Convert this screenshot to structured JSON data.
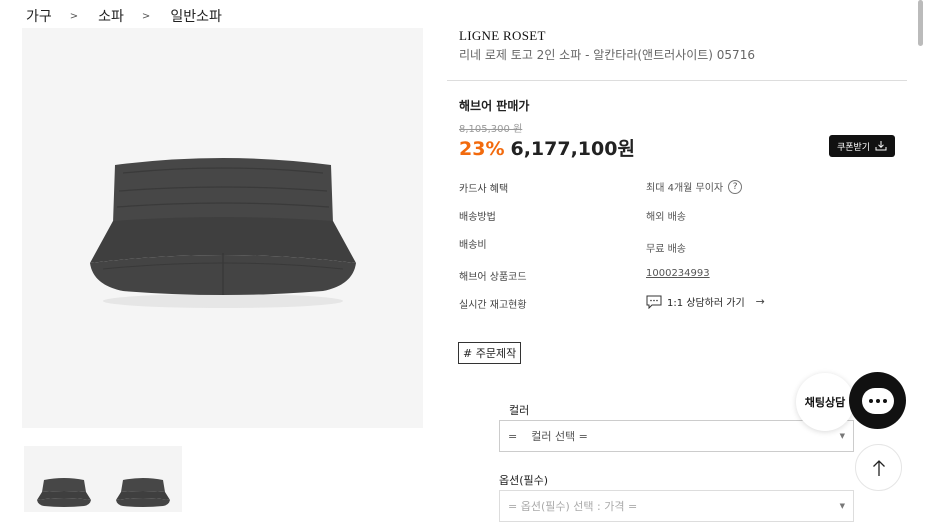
{
  "breadcrumb": {
    "items": [
      "가구",
      "소파",
      "일반소파"
    ],
    "separator": ">"
  },
  "product": {
    "brand": "LIGNE ROSET",
    "name": "리네 로제 토고 2인 소파 - 알칸타라(앤트러사이트) 05716"
  },
  "price": {
    "title": "해브어 판매가",
    "original": "8,105,300 원",
    "discount": "23%",
    "sale": "6,177,100원",
    "coupon_label": "쿠폰받기"
  },
  "info": [
    {
      "label": "카드사 혜택",
      "value": "최대 4개월 무이자"
    },
    {
      "label": "배송방법",
      "value": "해외 배송"
    },
    {
      "label": "배송비",
      "value": "무료 배송"
    },
    {
      "label": "해브어 상품코드",
      "value": "1000234993"
    },
    {
      "label": "실시간 재고현황",
      "value": "1:1 상담하러 가기"
    }
  ],
  "tag": "# 주문제작",
  "options": {
    "color_label": "컬러",
    "color_placeholder": "=    컬러 선택 =",
    "option_label": "옵션(필수)",
    "option_placeholder": "= 옵션(필수) 선택 : 가격 ="
  },
  "chat": {
    "label": "채팅상담"
  },
  "colors": {
    "accent": "#f26a0d",
    "dark": "#111111"
  },
  "icons": {
    "question": "question-circle-icon",
    "download": "download-icon",
    "chat": "chat-bubble-icon",
    "top": "arrow-up-icon",
    "consult": "speech-bubble-icon"
  }
}
